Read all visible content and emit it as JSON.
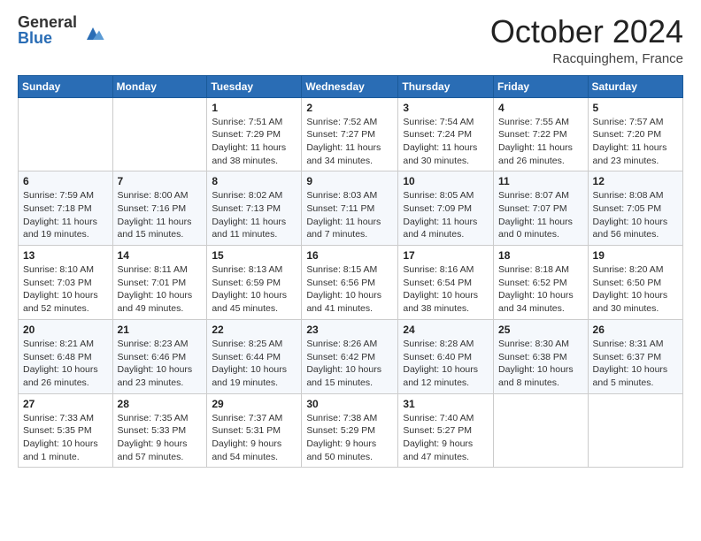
{
  "header": {
    "logo_general": "General",
    "logo_blue": "Blue",
    "month": "October 2024",
    "location": "Racquinghem, France"
  },
  "days_of_week": [
    "Sunday",
    "Monday",
    "Tuesday",
    "Wednesday",
    "Thursday",
    "Friday",
    "Saturday"
  ],
  "weeks": [
    [
      {
        "day": "",
        "info": ""
      },
      {
        "day": "",
        "info": ""
      },
      {
        "day": "1",
        "info": "Sunrise: 7:51 AM\nSunset: 7:29 PM\nDaylight: 11 hours and 38 minutes."
      },
      {
        "day": "2",
        "info": "Sunrise: 7:52 AM\nSunset: 7:27 PM\nDaylight: 11 hours and 34 minutes."
      },
      {
        "day": "3",
        "info": "Sunrise: 7:54 AM\nSunset: 7:24 PM\nDaylight: 11 hours and 30 minutes."
      },
      {
        "day": "4",
        "info": "Sunrise: 7:55 AM\nSunset: 7:22 PM\nDaylight: 11 hours and 26 minutes."
      },
      {
        "day": "5",
        "info": "Sunrise: 7:57 AM\nSunset: 7:20 PM\nDaylight: 11 hours and 23 minutes."
      }
    ],
    [
      {
        "day": "6",
        "info": "Sunrise: 7:59 AM\nSunset: 7:18 PM\nDaylight: 11 hours and 19 minutes."
      },
      {
        "day": "7",
        "info": "Sunrise: 8:00 AM\nSunset: 7:16 PM\nDaylight: 11 hours and 15 minutes."
      },
      {
        "day": "8",
        "info": "Sunrise: 8:02 AM\nSunset: 7:13 PM\nDaylight: 11 hours and 11 minutes."
      },
      {
        "day": "9",
        "info": "Sunrise: 8:03 AM\nSunset: 7:11 PM\nDaylight: 11 hours and 7 minutes."
      },
      {
        "day": "10",
        "info": "Sunrise: 8:05 AM\nSunset: 7:09 PM\nDaylight: 11 hours and 4 minutes."
      },
      {
        "day": "11",
        "info": "Sunrise: 8:07 AM\nSunset: 7:07 PM\nDaylight: 11 hours and 0 minutes."
      },
      {
        "day": "12",
        "info": "Sunrise: 8:08 AM\nSunset: 7:05 PM\nDaylight: 10 hours and 56 minutes."
      }
    ],
    [
      {
        "day": "13",
        "info": "Sunrise: 8:10 AM\nSunset: 7:03 PM\nDaylight: 10 hours and 52 minutes."
      },
      {
        "day": "14",
        "info": "Sunrise: 8:11 AM\nSunset: 7:01 PM\nDaylight: 10 hours and 49 minutes."
      },
      {
        "day": "15",
        "info": "Sunrise: 8:13 AM\nSunset: 6:59 PM\nDaylight: 10 hours and 45 minutes."
      },
      {
        "day": "16",
        "info": "Sunrise: 8:15 AM\nSunset: 6:56 PM\nDaylight: 10 hours and 41 minutes."
      },
      {
        "day": "17",
        "info": "Sunrise: 8:16 AM\nSunset: 6:54 PM\nDaylight: 10 hours and 38 minutes."
      },
      {
        "day": "18",
        "info": "Sunrise: 8:18 AM\nSunset: 6:52 PM\nDaylight: 10 hours and 34 minutes."
      },
      {
        "day": "19",
        "info": "Sunrise: 8:20 AM\nSunset: 6:50 PM\nDaylight: 10 hours and 30 minutes."
      }
    ],
    [
      {
        "day": "20",
        "info": "Sunrise: 8:21 AM\nSunset: 6:48 PM\nDaylight: 10 hours and 26 minutes."
      },
      {
        "day": "21",
        "info": "Sunrise: 8:23 AM\nSunset: 6:46 PM\nDaylight: 10 hours and 23 minutes."
      },
      {
        "day": "22",
        "info": "Sunrise: 8:25 AM\nSunset: 6:44 PM\nDaylight: 10 hours and 19 minutes."
      },
      {
        "day": "23",
        "info": "Sunrise: 8:26 AM\nSunset: 6:42 PM\nDaylight: 10 hours and 15 minutes."
      },
      {
        "day": "24",
        "info": "Sunrise: 8:28 AM\nSunset: 6:40 PM\nDaylight: 10 hours and 12 minutes."
      },
      {
        "day": "25",
        "info": "Sunrise: 8:30 AM\nSunset: 6:38 PM\nDaylight: 10 hours and 8 minutes."
      },
      {
        "day": "26",
        "info": "Sunrise: 8:31 AM\nSunset: 6:37 PM\nDaylight: 10 hours and 5 minutes."
      }
    ],
    [
      {
        "day": "27",
        "info": "Sunrise: 7:33 AM\nSunset: 5:35 PM\nDaylight: 10 hours and 1 minute."
      },
      {
        "day": "28",
        "info": "Sunrise: 7:35 AM\nSunset: 5:33 PM\nDaylight: 9 hours and 57 minutes."
      },
      {
        "day": "29",
        "info": "Sunrise: 7:37 AM\nSunset: 5:31 PM\nDaylight: 9 hours and 54 minutes."
      },
      {
        "day": "30",
        "info": "Sunrise: 7:38 AM\nSunset: 5:29 PM\nDaylight: 9 hours and 50 minutes."
      },
      {
        "day": "31",
        "info": "Sunrise: 7:40 AM\nSunset: 5:27 PM\nDaylight: 9 hours and 47 minutes."
      },
      {
        "day": "",
        "info": ""
      },
      {
        "day": "",
        "info": ""
      }
    ]
  ]
}
